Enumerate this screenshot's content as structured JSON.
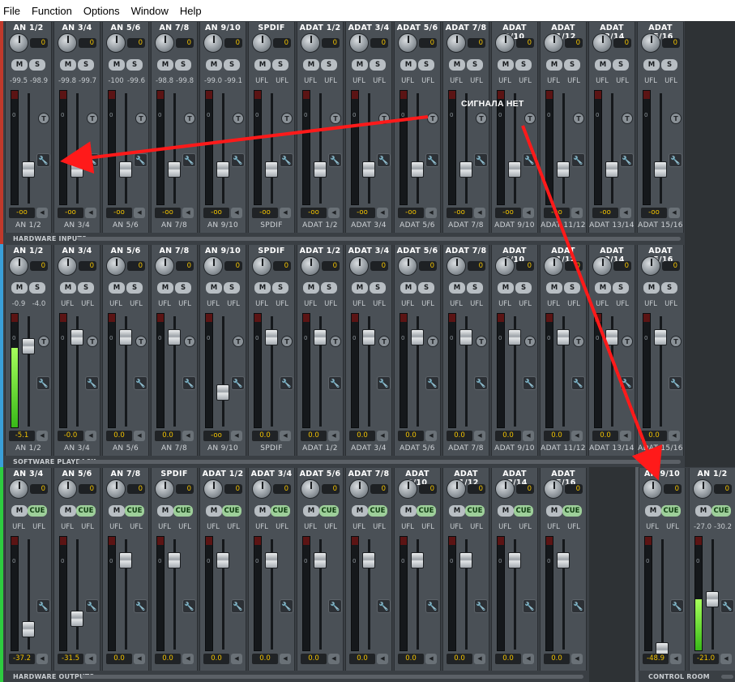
{
  "menu": [
    "File",
    "Function",
    "Options",
    "Window",
    "Help"
  ],
  "sections": [
    {
      "id": "hardware-inputs",
      "label": "HARDWARE INPUTS",
      "accent": "#c0392b",
      "channels": [
        {
          "name": "AN 1/2",
          "gain": "0",
          "btn2": "S",
          "lvl_l": "-99.5",
          "lvl_r": "-98.9",
          "value": "-oo",
          "footer": "AN 1/2",
          "fader_db": -30,
          "meter": 0
        },
        {
          "name": "AN 3/4",
          "gain": "0",
          "btn2": "S",
          "lvl_l": "-99.8",
          "lvl_r": "-99.7",
          "value": "-oo",
          "footer": "AN 3/4",
          "fader_db": -30,
          "meter": 0
        },
        {
          "name": "AN 5/6",
          "gain": "0",
          "btn2": "S",
          "lvl_l": "-100",
          "lvl_r": "-99.6",
          "value": "-oo",
          "footer": "AN 5/6",
          "fader_db": -30,
          "meter": 0
        },
        {
          "name": "AN 7/8",
          "gain": "0",
          "btn2": "S",
          "lvl_l": "-98.8",
          "lvl_r": "-99.8",
          "value": "-oo",
          "footer": "AN 7/8",
          "fader_db": -30,
          "meter": 0
        },
        {
          "name": "AN 9/10",
          "gain": "0",
          "btn2": "S",
          "lvl_l": "-99.0",
          "lvl_r": "-99.1",
          "value": "-oo",
          "footer": "AN 9/10",
          "fader_db": -30,
          "meter": 0
        },
        {
          "name": "SPDIF",
          "gain": "0",
          "btn2": "S",
          "lvl_l": "UFL",
          "lvl_r": "UFL",
          "value": "-oo",
          "footer": "SPDIF",
          "fader_db": -30,
          "meter": 0
        },
        {
          "name": "ADAT 1/2",
          "gain": "0",
          "btn2": "S",
          "lvl_l": "UFL",
          "lvl_r": "UFL",
          "value": "-oo",
          "footer": "ADAT 1/2",
          "fader_db": -30,
          "meter": 0
        },
        {
          "name": "ADAT 3/4",
          "gain": "0",
          "btn2": "S",
          "lvl_l": "UFL",
          "lvl_r": "UFL",
          "value": "-oo",
          "footer": "ADAT 3/4",
          "fader_db": -30,
          "meter": 0
        },
        {
          "name": "ADAT 5/6",
          "gain": "0",
          "btn2": "S",
          "lvl_l": "UFL",
          "lvl_r": "UFL",
          "value": "-oo",
          "footer": "ADAT 5/6",
          "fader_db": -30,
          "meter": 0
        },
        {
          "name": "ADAT 7/8",
          "gain": "0",
          "btn2": "S",
          "lvl_l": "UFL",
          "lvl_r": "UFL",
          "value": "-oo",
          "footer": "ADAT 7/8",
          "fader_db": -30,
          "meter": 0
        },
        {
          "name": "ADAT 9/10",
          "gain": "0",
          "btn2": "S",
          "lvl_l": "UFL",
          "lvl_r": "UFL",
          "value": "-oo",
          "footer": "ADAT 9/10",
          "fader_db": -30,
          "meter": 0
        },
        {
          "name": "ADAT 11/12",
          "gain": "0",
          "btn2": "S",
          "lvl_l": "UFL",
          "lvl_r": "UFL",
          "value": "-oo",
          "footer": "ADAT 11/12",
          "fader_db": -30,
          "meter": 0
        },
        {
          "name": "ADAT 13/14",
          "gain": "0",
          "btn2": "S",
          "lvl_l": "UFL",
          "lvl_r": "UFL",
          "value": "-oo",
          "footer": "ADAT 13/14",
          "fader_db": -30,
          "meter": 0
        },
        {
          "name": "ADAT 15/16",
          "gain": "0",
          "btn2": "S",
          "lvl_l": "UFL",
          "lvl_r": "UFL",
          "value": "-oo",
          "footer": "ADAT 15/16",
          "fader_db": -30,
          "meter": 0
        }
      ]
    },
    {
      "id": "software-playback",
      "label": "SOFTWARE PLAYBACK",
      "accent": "#3a9fd8",
      "channels": [
        {
          "name": "AN 1/2",
          "gain": "0",
          "btn2": "S",
          "lvl_l": "-0.9",
          "lvl_r": "-4.0",
          "value": "-5.1",
          "footer": "AN 1/2",
          "fader_db": -5.1,
          "meter": 0.7
        },
        {
          "name": "AN 3/4",
          "gain": "0",
          "btn2": "S",
          "lvl_l": "UFL",
          "lvl_r": "UFL",
          "value": "-0.0",
          "footer": "AN 3/4",
          "fader_db": 0,
          "meter": 0
        },
        {
          "name": "AN 5/6",
          "gain": "0",
          "btn2": "S",
          "lvl_l": "UFL",
          "lvl_r": "UFL",
          "value": "0.0",
          "footer": "AN 5/6",
          "fader_db": 0,
          "meter": 0
        },
        {
          "name": "AN 7/8",
          "gain": "0",
          "btn2": "S",
          "lvl_l": "UFL",
          "lvl_r": "UFL",
          "value": "0.0",
          "footer": "AN 7/8",
          "fader_db": 0,
          "meter": 0
        },
        {
          "name": "AN 9/10",
          "gain": "0",
          "btn2": "S",
          "lvl_l": "UFL",
          "lvl_r": "UFL",
          "value": "-oo",
          "footer": "AN 9/10",
          "fader_db": -30,
          "meter": 0
        },
        {
          "name": "SPDIF",
          "gain": "0",
          "btn2": "S",
          "lvl_l": "UFL",
          "lvl_r": "UFL",
          "value": "0.0",
          "footer": "SPDIF",
          "fader_db": 0,
          "meter": 0
        },
        {
          "name": "ADAT 1/2",
          "gain": "0",
          "btn2": "S",
          "lvl_l": "UFL",
          "lvl_r": "UFL",
          "value": "0.0",
          "footer": "ADAT 1/2",
          "fader_db": 0,
          "meter": 0
        },
        {
          "name": "ADAT 3/4",
          "gain": "0",
          "btn2": "S",
          "lvl_l": "UFL",
          "lvl_r": "UFL",
          "value": "0.0",
          "footer": "ADAT 3/4",
          "fader_db": 0,
          "meter": 0
        },
        {
          "name": "ADAT 5/6",
          "gain": "0",
          "btn2": "S",
          "lvl_l": "UFL",
          "lvl_r": "UFL",
          "value": "0.0",
          "footer": "ADAT 5/6",
          "fader_db": 0,
          "meter": 0
        },
        {
          "name": "ADAT 7/8",
          "gain": "0",
          "btn2": "S",
          "lvl_l": "UFL",
          "lvl_r": "UFL",
          "value": "0.0",
          "footer": "ADAT 7/8",
          "fader_db": 0,
          "meter": 0
        },
        {
          "name": "ADAT 9/10",
          "gain": "0",
          "btn2": "S",
          "lvl_l": "UFL",
          "lvl_r": "UFL",
          "value": "0.0",
          "footer": "ADAT 9/10",
          "fader_db": 0,
          "meter": 0
        },
        {
          "name": "ADAT 11/12",
          "gain": "0",
          "btn2": "S",
          "lvl_l": "UFL",
          "lvl_r": "UFL",
          "value": "0.0",
          "footer": "ADAT 11/12",
          "fader_db": 0,
          "meter": 0
        },
        {
          "name": "ADAT 13/14",
          "gain": "0",
          "btn2": "S",
          "lvl_l": "UFL",
          "lvl_r": "UFL",
          "value": "0.0",
          "footer": "ADAT 13/14",
          "fader_db": 0,
          "meter": 0
        },
        {
          "name": "ADAT 15/16",
          "gain": "0",
          "btn2": "S",
          "lvl_l": "UFL",
          "lvl_r": "UFL",
          "value": "0.0",
          "footer": "ADAT 15/16",
          "fader_db": 0,
          "meter": 0
        }
      ]
    },
    {
      "id": "hardware-outputs",
      "label": "HARDWARE OUTPUTS",
      "accent": "#2ecc40",
      "channels": [
        {
          "name": "AN 3/4",
          "gain": "0",
          "btn2": "CUE",
          "lvl_l": "UFL",
          "lvl_r": "UFL",
          "value": "-37.2",
          "footer": "",
          "fader_db": -37.2,
          "meter": 0
        },
        {
          "name": "AN 5/6",
          "gain": "0",
          "btn2": "CUE",
          "lvl_l": "UFL",
          "lvl_r": "UFL",
          "value": "-31.5",
          "footer": "",
          "fader_db": -31.5,
          "meter": 0
        },
        {
          "name": "AN 7/8",
          "gain": "0",
          "btn2": "CUE",
          "lvl_l": "UFL",
          "lvl_r": "UFL",
          "value": "0.0",
          "footer": "",
          "fader_db": 0,
          "meter": 0
        },
        {
          "name": "SPDIF",
          "gain": "0",
          "btn2": "CUE",
          "lvl_l": "UFL",
          "lvl_r": "UFL",
          "value": "0.0",
          "footer": "",
          "fader_db": 0,
          "meter": 0
        },
        {
          "name": "ADAT 1/2",
          "gain": "0",
          "btn2": "CUE",
          "lvl_l": "UFL",
          "lvl_r": "UFL",
          "value": "0.0",
          "footer": "",
          "fader_db": 0,
          "meter": 0
        },
        {
          "name": "ADAT 3/4",
          "gain": "0",
          "btn2": "CUE",
          "lvl_l": "UFL",
          "lvl_r": "UFL",
          "value": "0.0",
          "footer": "",
          "fader_db": 0,
          "meter": 0
        },
        {
          "name": "ADAT 5/6",
          "gain": "0",
          "btn2": "CUE",
          "lvl_l": "UFL",
          "lvl_r": "UFL",
          "value": "0.0",
          "footer": "",
          "fader_db": 0,
          "meter": 0
        },
        {
          "name": "ADAT 7/8",
          "gain": "0",
          "btn2": "CUE",
          "lvl_l": "UFL",
          "lvl_r": "UFL",
          "value": "0.0",
          "footer": "",
          "fader_db": 0,
          "meter": 0
        },
        {
          "name": "ADAT 9/10",
          "gain": "0",
          "btn2": "CUE",
          "lvl_l": "UFL",
          "lvl_r": "UFL",
          "value": "0.0",
          "footer": "",
          "fader_db": 0,
          "meter": 0
        },
        {
          "name": "ADAT 11/12",
          "gain": "0",
          "btn2": "CUE",
          "lvl_l": "UFL",
          "lvl_r": "UFL",
          "value": "0.0",
          "footer": "",
          "fader_db": 0,
          "meter": 0
        },
        {
          "name": "ADAT 13/14",
          "gain": "0",
          "btn2": "CUE",
          "lvl_l": "UFL",
          "lvl_r": "UFL",
          "value": "0.0",
          "footer": "",
          "fader_db": 0,
          "meter": 0
        },
        {
          "name": "ADAT 15/16",
          "gain": "0",
          "btn2": "CUE",
          "lvl_l": "UFL",
          "lvl_r": "UFL",
          "value": "0.0",
          "footer": "",
          "fader_db": 0,
          "meter": 0
        }
      ]
    },
    {
      "id": "control-room",
      "label": "CONTROL ROOM",
      "accent": "#5a6066",
      "channels": [
        {
          "name": "AN 9/10",
          "gain": "0",
          "btn2": "CUE",
          "lvl_l": "UFL",
          "lvl_r": "UFL",
          "value": "-48.9",
          "footer": "",
          "fader_db": -48.9,
          "meter": 0
        },
        {
          "name": "AN 1/2",
          "gain": "0",
          "btn2": "CUE",
          "lvl_l": "-27.0",
          "lvl_r": "-30.2",
          "value": "-21.0",
          "footer": "",
          "fader_db": -21.0,
          "meter": 0.45
        }
      ]
    }
  ],
  "annotation": "СИГНАЛА НЕТ",
  "colors": {
    "arrow": "#ff1a1a",
    "value": "#f2c200",
    "meter_green": "#5ad12a"
  }
}
